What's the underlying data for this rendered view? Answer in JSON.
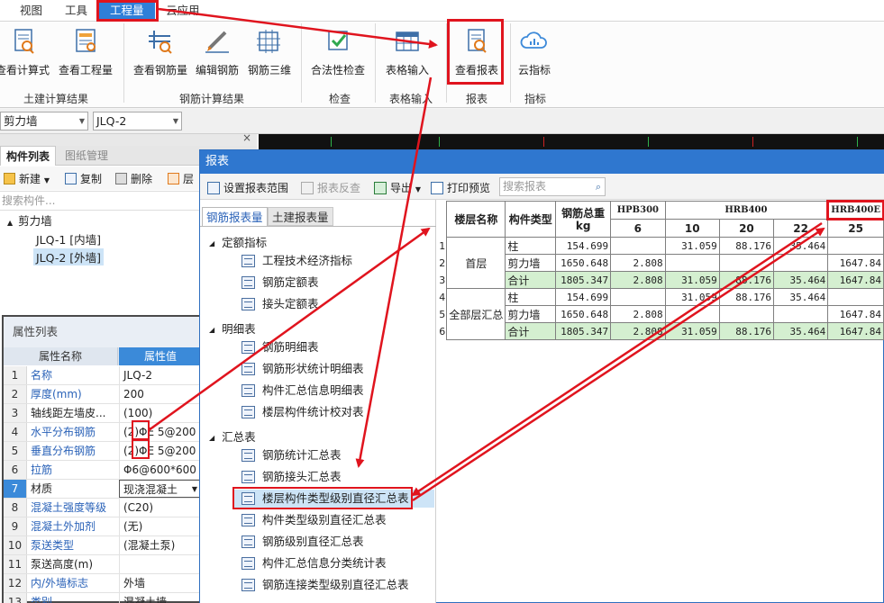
{
  "menu": {
    "items": [
      "视图",
      "工具",
      "工程量",
      "云应用"
    ],
    "active_index": 2
  },
  "ribbon": {
    "buttons": [
      "查看计算式",
      "查看工程量",
      "查看钢筋量",
      "编辑钢筋",
      "钢筋三维",
      "合法性检查",
      "表格输入",
      "查看报表",
      "云指标"
    ],
    "groups": [
      "土建计算结果",
      "钢筋计算结果",
      "检查",
      "表格输入",
      "报表",
      "指标"
    ]
  },
  "selectors": {
    "type_value": "剪力墙",
    "item_value": "JLQ-2"
  },
  "left_panel": {
    "tabs": [
      "构件列表",
      "图纸管理"
    ],
    "tools": [
      "新建",
      "复制",
      "删除",
      "层"
    ],
    "search_placeholder": "搜索构件...",
    "tree": {
      "root": "剪力墙",
      "children": [
        "JLQ-1 [内墙]",
        "JLQ-2 [外墙]"
      ],
      "selected_index": 1
    },
    "close_glyph": "×"
  },
  "properties": {
    "title": "属性列表",
    "col_name": "属性名称",
    "col_value": "属性值",
    "rows": [
      {
        "num": "1",
        "name": "名称",
        "value": "JLQ-2",
        "blue": true
      },
      {
        "num": "2",
        "name": "厚度(mm)",
        "value": "200",
        "blue": true
      },
      {
        "num": "3",
        "name": "轴线距左墙皮...",
        "value": "(100)",
        "blue": false
      },
      {
        "num": "4",
        "name": "水平分布钢筋",
        "value": "(2)ΦE 5@200",
        "blue": true
      },
      {
        "num": "5",
        "name": "垂直分布钢筋",
        "value": "(2)ΦE 5@200",
        "blue": true
      },
      {
        "num": "6",
        "name": "拉筋",
        "value": "Φ6@600*600",
        "blue": true
      },
      {
        "num": "7",
        "name": "材质",
        "value": "现浇混凝土",
        "blue": false
      },
      {
        "num": "8",
        "name": "混凝土强度等级",
        "value": "(C20)",
        "blue": true
      },
      {
        "num": "9",
        "name": "混凝土外加剂",
        "value": "(无)",
        "blue": true
      },
      {
        "num": "10",
        "name": "泵送类型",
        "value": "(混凝土泵)",
        "blue": true
      },
      {
        "num": "11",
        "name": "泵送高度(m)",
        "value": "",
        "blue": false
      },
      {
        "num": "12",
        "name": "内/外墙标志",
        "value": "外墙",
        "blue": true
      },
      {
        "num": "13",
        "name": "类别",
        "value": "混凝土墙",
        "blue": true
      }
    ]
  },
  "dialog": {
    "title": "报表",
    "tools": [
      "设置报表范围",
      "报表反查",
      "导出",
      "打印预览"
    ],
    "search_placeholder": "搜索报表",
    "tabs": [
      "钢筋报表量",
      "土建报表量"
    ],
    "groups": [
      {
        "label": "定额指标",
        "items": [
          "工程技术经济指标",
          "钢筋定额表",
          "接头定额表"
        ]
      },
      {
        "label": "明细表",
        "items": [
          "钢筋明细表",
          "钢筋形状统计明细表",
          "构件汇总信息明细表",
          "楼层构件统计校对表"
        ]
      },
      {
        "label": "汇总表",
        "items": [
          "钢筋统计汇总表",
          "钢筋接头汇总表",
          "楼层构件类型级别直径汇总表",
          "构件类型级别直径汇总表",
          "钢筋级别直径汇总表",
          "构件汇总信息分类统计表",
          "钢筋连接类型级别直径汇总表"
        ]
      }
    ]
  },
  "report": {
    "headers": {
      "floor": "楼层名称",
      "type": "构件类型",
      "total": "钢筋总重",
      "unit": "kg",
      "grades": [
        "HPB300",
        "HRB400",
        "HRB400E"
      ],
      "diameters": [
        "6",
        "10",
        "20",
        "22",
        "25"
      ]
    },
    "floors": [
      "首层",
      "全部层汇总"
    ],
    "rows": [
      {
        "rn": "1",
        "type": "柱",
        "total": "154.699",
        "d6": "",
        "d10": "31.059",
        "d20": "88.176",
        "d22": "35.464",
        "d25": "",
        "green": false
      },
      {
        "rn": "2",
        "type": "剪力墙",
        "total": "1650.648",
        "d6": "2.808",
        "d10": "",
        "d20": "",
        "d22": "",
        "d25": "1647.84",
        "green": false
      },
      {
        "rn": "3",
        "type": "合计",
        "total": "1805.347",
        "d6": "2.808",
        "d10": "31.059",
        "d20": "88.176",
        "d22": "35.464",
        "d25": "1647.84",
        "green": true
      },
      {
        "rn": "4",
        "type": "柱",
        "total": "154.699",
        "d6": "",
        "d10": "31.059",
        "d20": "88.176",
        "d22": "35.464",
        "d25": "",
        "green": false
      },
      {
        "rn": "5",
        "type": "剪力墙",
        "total": "1650.648",
        "d6": "2.808",
        "d10": "",
        "d20": "",
        "d22": "",
        "d25": "1647.84",
        "green": false
      },
      {
        "rn": "6",
        "type": "合计",
        "total": "1805.347",
        "d6": "2.808",
        "d10": "31.059",
        "d20": "88.176",
        "d22": "35.464",
        "d25": "1647.84",
        "green": true
      }
    ]
  },
  "colors": {
    "accent": "#2f77cf",
    "highlight": "#e0141e",
    "total_row": "#d4efd0"
  }
}
